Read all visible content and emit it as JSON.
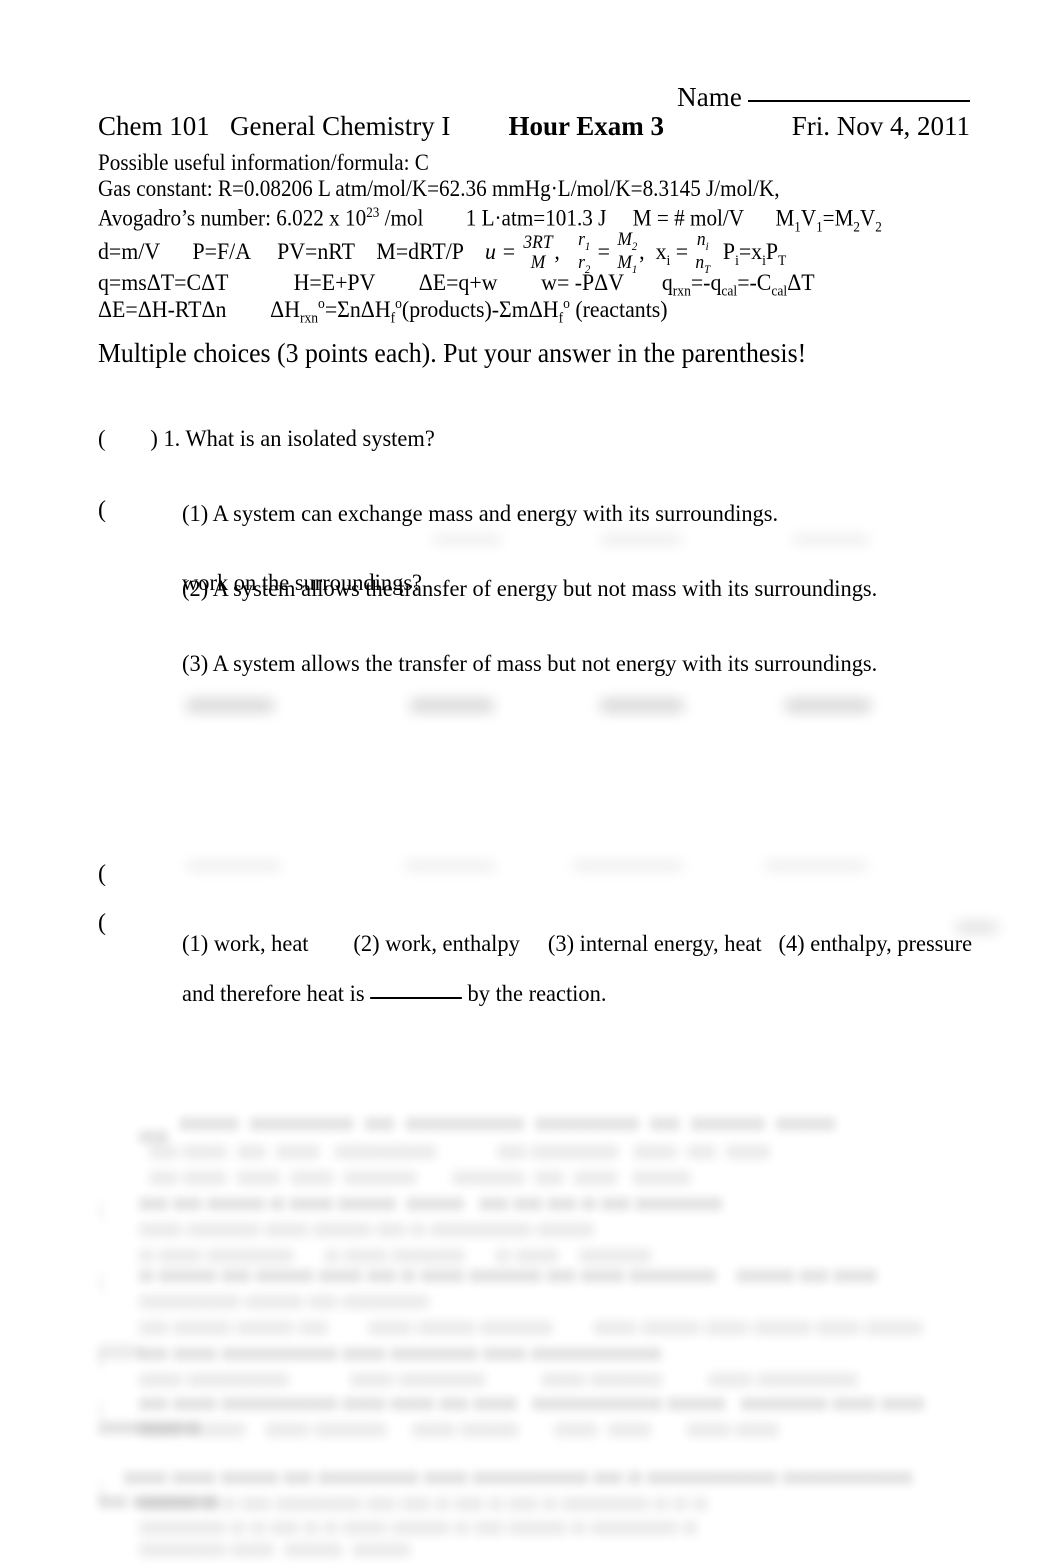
{
  "document": {
    "type": "exam-paper",
    "page_background": "#ffffff",
    "text_color": "#000000"
  },
  "header": {
    "name_label": "Name",
    "course": "Chem 101   General Chemistry I",
    "exam_title": "Hour Exam 3",
    "date": "Fri. Nov 4, 2011"
  },
  "info": {
    "line1": "Possible useful information/formula: C",
    "line2": "Gas constant: R=0.08206 L atm/mol/K=62.36 mmHg·L/mol/K=8.3145 J/mol/K,",
    "line3_a": "Avogadro’s number: 6.022 x 10",
    "line3_sup": "23",
    "line3_b": " /mol",
    "line3_c": "1 L·atm=101.3 J",
    "line3_d": "M = # mol/V",
    "line3_e": "M",
    "line3_e_sub1": "1",
    "line3_e_mid": "V",
    "line3_e_sub2": "1",
    "line3_e_eq": "=M",
    "line3_e_sub3": "2",
    "line3_e_end": "V",
    "line3_e_sub4": "2"
  },
  "formulas": {
    "row1": {
      "f1": "d=m/V",
      "f2": "P=F/A",
      "f3": "PV=nRT",
      "f4": "M=dRT/P",
      "f5_lhs": "u =",
      "f5_num": "3RT",
      "f5_den": "M",
      "f6_num": "r",
      "f6_num_sub": "1",
      "f6_den": "r",
      "f6_den_sub": "2",
      "f6_eq": "=",
      "f6_num2": "M",
      "f6_num2_sub": "2",
      "f6_den2": "M",
      "f6_den2_sub": "1",
      "f7_lhs": "x",
      "f7_lhs_sub": "i",
      "f7_eq": "=",
      "f7_num": "n",
      "f7_num_sub": "i",
      "f7_den": "n",
      "f7_den_sub": "T",
      "f8": "P",
      "f8_sub1": "i",
      "f8_mid": "=x",
      "f8_sub2": "i",
      "f8_end": "P",
      "f8_sub3": "T"
    },
    "row2": {
      "f1": "q=msΔT=CΔT",
      "f2": "H=E+PV",
      "f3": "ΔE=q+w",
      "f4": "w= -PΔV",
      "f5": "q",
      "f5_sub": "rxn",
      "f5_mid": "=-q",
      "f5_sub2": "cal",
      "f5_mid2": "=-C",
      "f5_sub3": "cal",
      "f5_end": "ΔT"
    },
    "row3": {
      "f1": "ΔE=ΔH-RTΔn",
      "f2_a": "ΔH",
      "f2_sub": "rxn",
      "f2_sup": "o",
      "f2_b": "=ΣnΔH",
      "f2_sub2": "f",
      "f2_sup2": "o",
      "f2_c": "(products)-ΣmΔH",
      "f2_sub3": "f",
      "f2_sup3": "o",
      "f2_d": " (reactants)"
    }
  },
  "section_heading": "Multiple choices (3 points each). Put your answer in the parenthesis!",
  "questions": [
    {
      "marker_open": "(",
      "marker_close": ")",
      "number": "1.",
      "stem": "What is an isolated system?",
      "choices": [
        "(1) A system can exchange mass and energy with its surroundings.",
        "(2) A system allows the transfer of energy but not mass with its surroundings.",
        "(3) A system allows the transfer of mass but not energy with its surroundings."
      ]
    },
    {
      "marker_open": "(",
      "stem_visible": "work on the surroundings?",
      "choices": []
    },
    {
      "marker_open": "(",
      "choices": [
        "(1) work, heat",
        "(2) work, enthalpy",
        "(3) internal energy, heat",
        "(4) enthalpy, pressure"
      ]
    },
    {
      "marker_open": "(",
      "stem_visible_a": "and therefore heat is ",
      "stem_visible_blank": "",
      "stem_visible_b": " by the reaction."
    }
  ],
  "illegible_note": "Lower portion of the page is blurred/faded in the source image; text is not legible."
}
